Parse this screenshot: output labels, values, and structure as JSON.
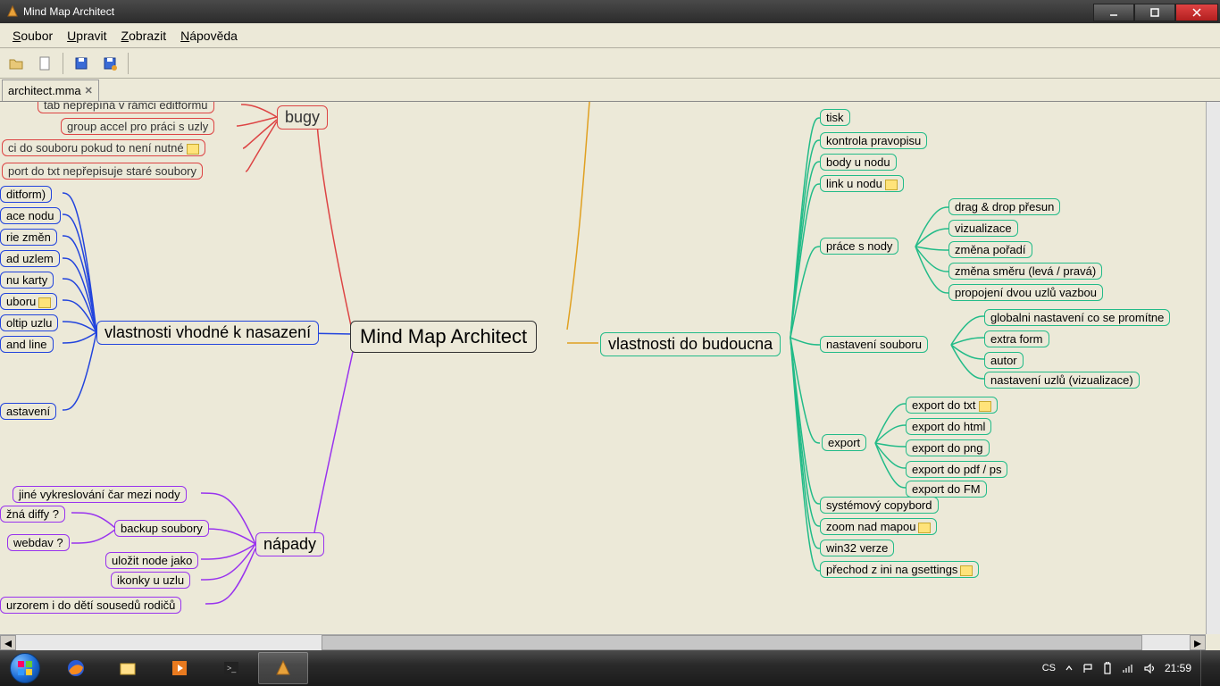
{
  "window": {
    "title": "Mind Map Architect"
  },
  "menu": {
    "soubor": "Soubor",
    "upravit": "Upravit",
    "zobrazit": "Zobrazit",
    "napoveda": "Nápověda"
  },
  "tab": {
    "name": "architect.mma"
  },
  "nodes": {
    "center": "Mind Map Architect",
    "bugy": "bugy",
    "bugy1": "tab nepřepíná v rámci editformu",
    "bugy2": "group accel pro práci s uzly",
    "bugy3": "ci do souboru pokud to není nutné",
    "bugy4": "port do txt nepřepisuje staré soubory",
    "vhodne": "vlastnosti vhodné k nasazení",
    "v1": "ditform)",
    "v2": "ace nodu",
    "v3": "rie změn",
    "v4": "ad uzlem",
    "v5": "nu karty",
    "v6": "uboru",
    "v7": "oltip uzlu",
    "v8": "and line",
    "v9": "astavení",
    "napady": "nápady",
    "n1": "jiné vykreslování čar mezi nody",
    "n2": "žná diffy ?",
    "n3": "webdav ?",
    "n4": "backup soubory",
    "n5": "uložit node jako",
    "n6": "ikonky u uzlu",
    "n7": "urzorem i do dětí sousedů rodičů",
    "budoucna": "vlastnosti do budoucna",
    "b1": "tisk",
    "b2": "kontrola pravopisu",
    "b3": "body u nodu",
    "b4": "link u nodu",
    "prace": "práce s nody",
    "p1": "drag & drop přesun",
    "p2": "vizualizace",
    "p3": "změna pořadí",
    "p4": "změna směru (levá / pravá)",
    "p5": "propojení dvou uzlů vazbou",
    "nastaveni": "nastavení souboru",
    "ns1": "globalni nastavení co se promítne",
    "ns2": "extra form",
    "ns3": "autor",
    "ns4": "nastavení uzlů (vizualizace)",
    "export": "export",
    "e1": "export do txt",
    "e2": "export do html",
    "e3": "export do png",
    "e4": "export do pdf / ps",
    "e5": "export do FM",
    "b5": "systémový copybord",
    "b6": "zoom nad mapou",
    "b7": "win32 verze",
    "b8": "přechod z ini na gsettings"
  },
  "taskbar": {
    "lang": "CS",
    "time": "21:59"
  }
}
